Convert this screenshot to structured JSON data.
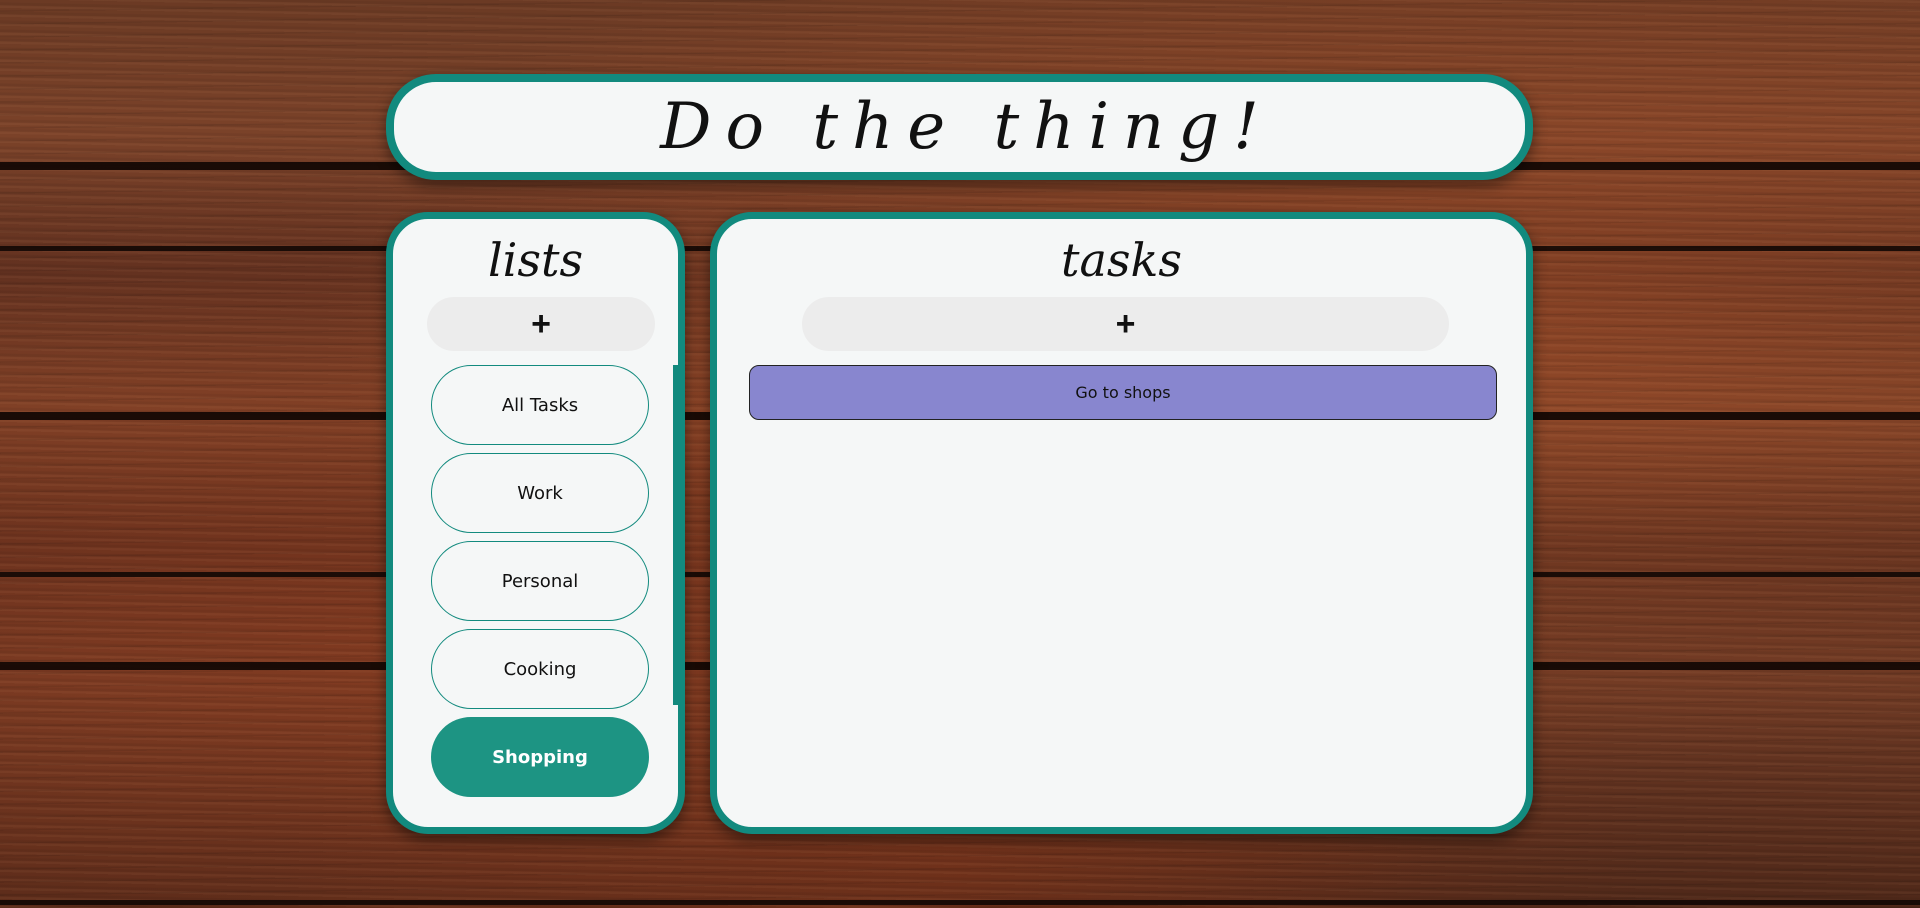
{
  "header": {
    "title": "Do the thing!"
  },
  "lists_panel": {
    "title": "lists",
    "add_label": "+",
    "items": [
      {
        "label": "All Tasks",
        "active": false
      },
      {
        "label": "Work",
        "active": false
      },
      {
        "label": "Personal",
        "active": false
      },
      {
        "label": "Cooking",
        "active": false
      },
      {
        "label": "Shopping",
        "active": true
      }
    ]
  },
  "tasks_panel": {
    "title": "tasks",
    "add_label": "+",
    "items": [
      {
        "label": "Go to shops"
      }
    ]
  },
  "colors": {
    "accent": "#128a7e",
    "active_list": "#1d9483",
    "task_fill": "#8886cf",
    "panel_bg": "#f5f7f7",
    "add_button_bg": "#ececec"
  }
}
